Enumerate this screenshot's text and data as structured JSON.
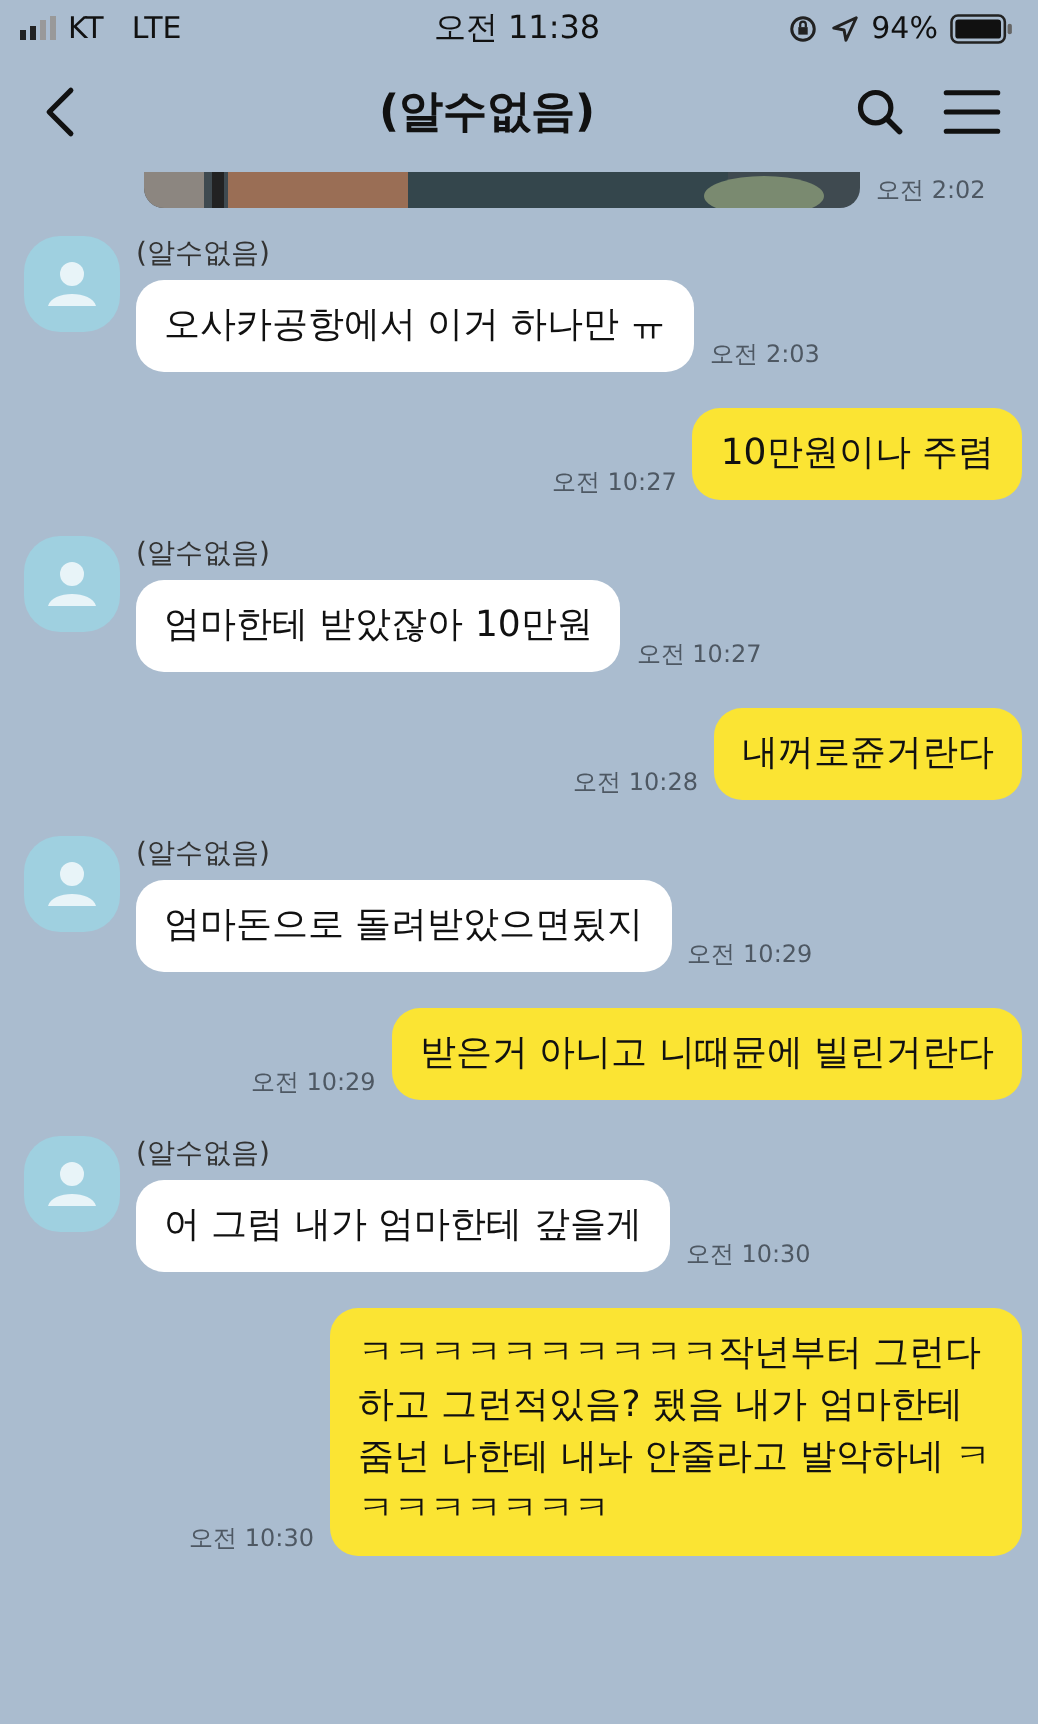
{
  "status_bar": {
    "carrier": "KT",
    "network": "LTE",
    "time": "오전 11:38",
    "battery": "94%"
  },
  "header": {
    "title": "(알수없음)"
  },
  "top_photo": {
    "kind": "picture",
    "time": "오전 2:02"
  },
  "messages": [
    {
      "kind": "in",
      "sender": "(알수없음)",
      "text": "오사카공항에서 이거 하나만 ㅠ",
      "time": "오전 2:03"
    },
    {
      "kind": "out",
      "text": "10만원이나 주렴",
      "time": "오전 10:27"
    },
    {
      "kind": "in",
      "sender": "(알수없음)",
      "text": "엄마한테 받았잖아 10만원",
      "time": "오전 10:27"
    },
    {
      "kind": "out",
      "text": "내꺼로쥰거란다",
      "time": "오전 10:28"
    },
    {
      "kind": "in",
      "sender": "(알수없음)",
      "text": "엄마돈으로 돌려받았으면됬지",
      "time": "오전 10:29"
    },
    {
      "kind": "out",
      "text": "받은거 아니고 니때뮨에 빌린거란다",
      "time": "오전 10:29"
    },
    {
      "kind": "in",
      "sender": "(알수없음)",
      "text": "어 그럼 내가 엄마한테 갚을게",
      "time": "오전 10:30"
    },
    {
      "kind": "out",
      "text": "ㅋㅋㅋㅋㅋㅋㅋㅋㅋㅋ작년부터 그런다하고 그런적있음? 됐음 내가 엄마한테줌넌 나한테 내놔 안줄라고 발악하네 ㅋㅋㅋㅋㅋㅋㅋㅋ",
      "time": "오전 10:30"
    }
  ]
}
